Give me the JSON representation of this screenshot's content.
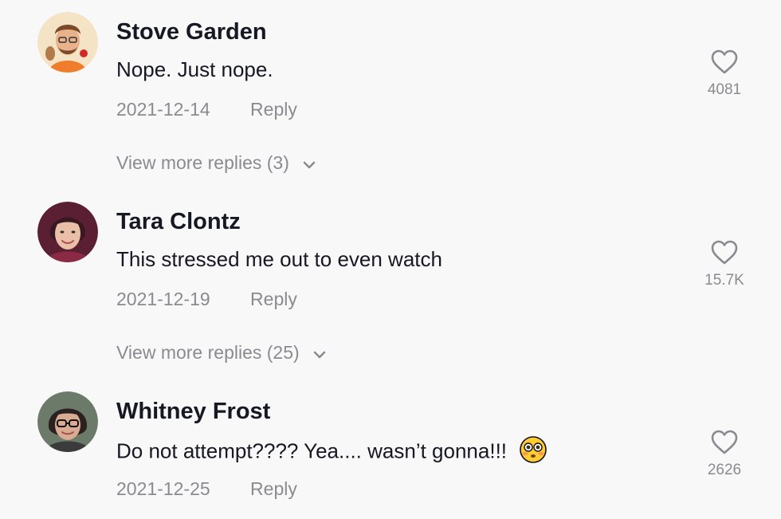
{
  "comments": [
    {
      "username": "Stove Garden",
      "text": "Nope. Just nope.",
      "date": "2021-12-14",
      "reply_label": "Reply",
      "likes": "4081",
      "more_replies": "View more replies (3)",
      "avatar_colors": {
        "bg": "#f4e3c4",
        "skin": "#e8b28c",
        "hair": "#7a4a2a",
        "shirt": "#ef7d2c"
      }
    },
    {
      "username": "Tara Clontz",
      "text": "This stressed me out to even watch",
      "date": "2021-12-19",
      "reply_label": "Reply",
      "likes": "15.7K",
      "more_replies": "View more replies (25)",
      "avatar_colors": {
        "bg": "#5a1f33",
        "skin": "#e9bfa8",
        "hair": "#3a1822",
        "shirt": "#8a2a44"
      }
    },
    {
      "username": "Whitney Frost",
      "text": "Do not attempt???? Yea.... wasn’t gonna!!!",
      "date": "2021-12-25",
      "reply_label": "Reply",
      "likes": "2626",
      "emoji": "flushed-face",
      "avatar_colors": {
        "bg": "#6c7a6a",
        "skin": "#d9ab92",
        "hair": "#2a2220",
        "shirt": "#3b3b3b"
      }
    }
  ],
  "colors": {
    "background": "#f8f8f8",
    "text": "#161823",
    "muted": "#8a8b91"
  },
  "icons": {
    "like": "heart-outline-icon",
    "expand": "chevron-down-icon"
  }
}
